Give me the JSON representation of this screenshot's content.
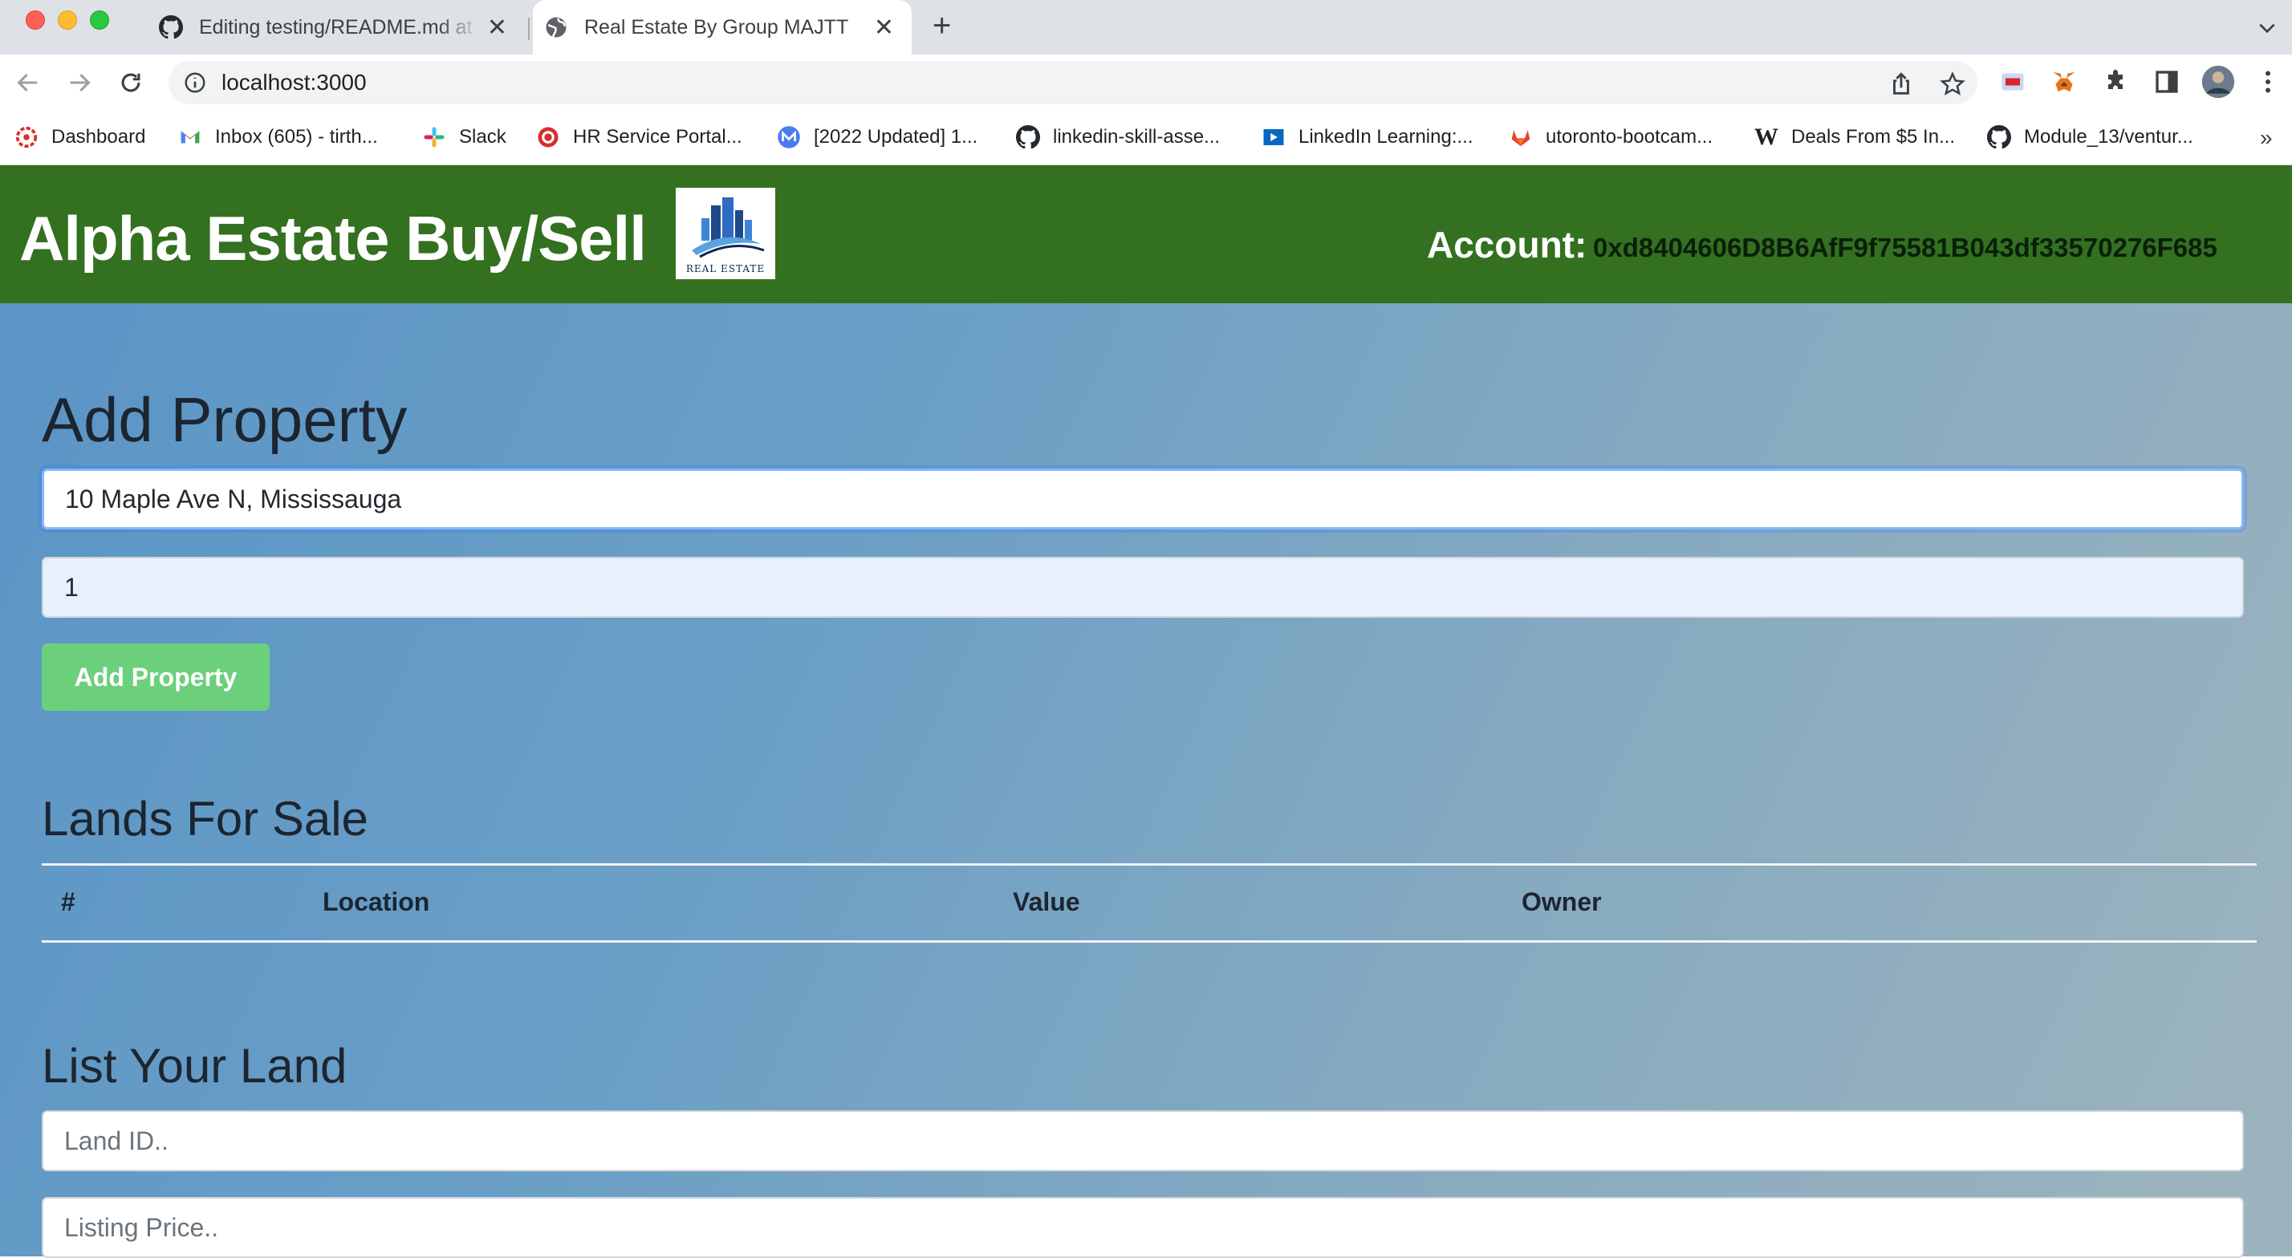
{
  "browser": {
    "tabs": [
      {
        "title": "Editing testing/README.md at",
        "icon": "github-icon",
        "active": false
      },
      {
        "title": "Real Estate By Group MAJTT",
        "icon": "globe-icon",
        "active": true
      }
    ],
    "url": "localhost:3000",
    "bookmarks": [
      {
        "label": "Dashboard",
        "icon": "dashboard-icon"
      },
      {
        "label": "Inbox (605) - tirth...",
        "icon": "gmail-icon"
      },
      {
        "label": "Slack",
        "icon": "slack-icon"
      },
      {
        "label": "HR Service Portal...",
        "icon": "hr-portal-icon"
      },
      {
        "label": "[2022 Updated] 1...",
        "icon": "m-icon"
      },
      {
        "label": "linkedin-skill-asse...",
        "icon": "github-icon"
      },
      {
        "label": "LinkedIn Learning:...",
        "icon": "linkedin-learning-icon"
      },
      {
        "label": "utoronto-bootcam...",
        "icon": "gitlab-icon"
      },
      {
        "label": "Deals From $5 In...",
        "icon": "w-icon"
      },
      {
        "label": "Module_13/ventur...",
        "icon": "github-icon"
      }
    ]
  },
  "header": {
    "title": "Alpha Estate Buy/Sell",
    "logo_text": "REAL ESTATE",
    "account_label": "Account:",
    "account_value": "0xd8404606D8B6AfF9f75581B043df33570276F685"
  },
  "add_property": {
    "heading": "Add Property",
    "location_value": "10 Maple Ave N, Mississauga",
    "value_value": "1",
    "button_label": "Add Property"
  },
  "lands_for_sale": {
    "heading": "Lands For Sale",
    "columns": [
      "#",
      "Location",
      "Value",
      "Owner"
    ],
    "rows": []
  },
  "list_land": {
    "heading": "List Your Land",
    "land_id_placeholder": "Land ID..",
    "price_placeholder": "Listing Price.."
  },
  "colors": {
    "header_bg": "#337020",
    "button_bg": "#6ccf7c",
    "accent_focus": "#86b7fe"
  }
}
